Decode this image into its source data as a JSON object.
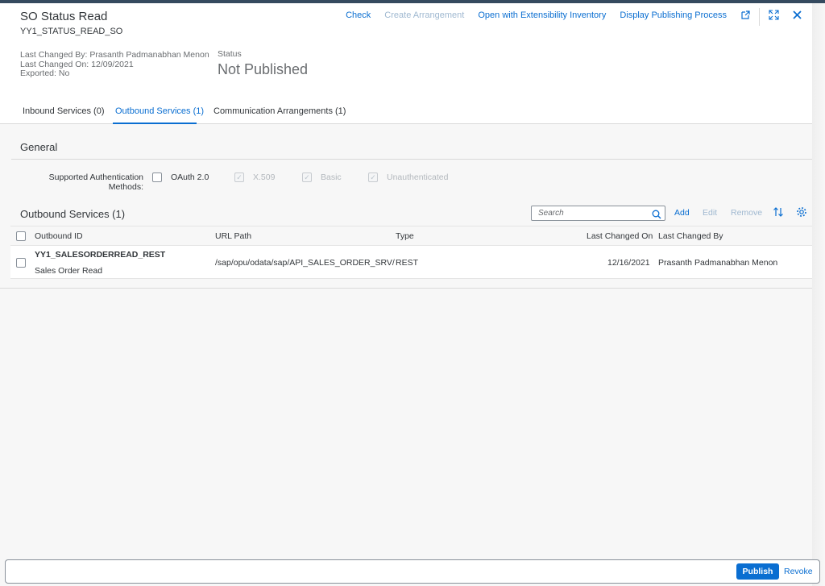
{
  "header": {
    "title": "SO Status Read",
    "subtitle": "YY1_STATUS_READ_SO",
    "last_changed_by": "Last Changed By: Prasanth Padmanabhan Menon",
    "last_changed_on": "Last Changed On: 12/09/2021",
    "exported": "Exported: No",
    "status_label": "Status",
    "status_value": "Not Published",
    "actions": {
      "check": "Check",
      "create_arrangement": "Create Arrangement",
      "open_extensibility": "Open with Extensibility Inventory",
      "display_publishing": "Display Publishing Process"
    }
  },
  "tabs": [
    {
      "label": "Inbound Services (0)"
    },
    {
      "label": "Outbound Services (1)"
    },
    {
      "label": "Communication Arrangements (1)"
    }
  ],
  "general": {
    "title": "General",
    "auth_label": "Supported Authentication Methods:",
    "options": [
      {
        "label": "OAuth 2.0",
        "checked": false,
        "enabled": true
      },
      {
        "label": "X.509",
        "checked": true,
        "enabled": false
      },
      {
        "label": "Basic",
        "checked": true,
        "enabled": false
      },
      {
        "label": "Unauthenticated",
        "checked": true,
        "enabled": false
      }
    ]
  },
  "outbound": {
    "title": "Outbound Services (1)",
    "search_placeholder": "Search",
    "add": "Add",
    "edit": "Edit",
    "remove": "Remove",
    "columns": [
      "Outbound ID",
      "URL Path",
      "Type",
      "Last Changed On",
      "Last Changed By"
    ],
    "rows": [
      {
        "id": "YY1_SALESORDERREAD_REST",
        "description": "Sales Order Read",
        "url_path": "/sap/opu/odata/sap/API_SALES_ORDER_SRV/",
        "type": "REST",
        "last_changed_on": "12/16/2021",
        "last_changed_by": "Prasanth Padmanabhan Menon"
      }
    ]
  },
  "footer": {
    "publish": "Publish",
    "revoke": "Revoke"
  },
  "colors": {
    "accent": "#0a6ed1",
    "shell": "#354a5f"
  }
}
